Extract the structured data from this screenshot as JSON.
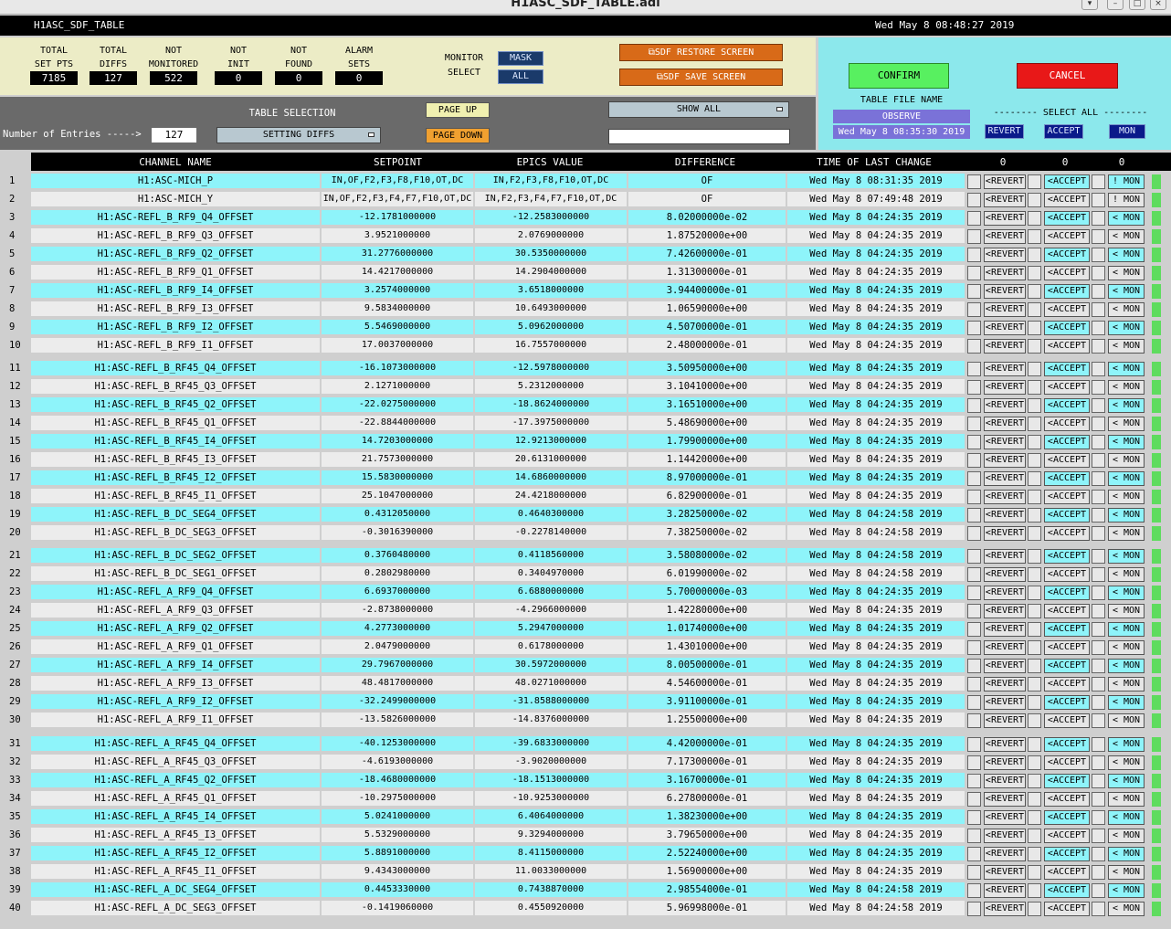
{
  "window": {
    "title": "H1ASC_SDF_TABLE.adl",
    "header_left": "H1ASC_SDF_TABLE",
    "header_right": "Wed May  8 08:48:27 2019"
  },
  "stats": [
    {
      "label1": "TOTAL",
      "label2": "SET PTS",
      "value": "7185"
    },
    {
      "label1": "TOTAL",
      "label2": "DIFFS",
      "value": "127"
    },
    {
      "label1": "NOT",
      "label2": "MONITORED",
      "value": "522"
    },
    {
      "label1": "NOT",
      "label2": "INIT",
      "value": "0"
    },
    {
      "label1": "NOT",
      "label2": "FOUND",
      "value": "0"
    },
    {
      "label1": "ALARM",
      "label2": "SETS",
      "value": "0"
    }
  ],
  "monitor": {
    "label1": "MONITOR",
    "label2": "SELECT",
    "mask": "MASK",
    "all": "ALL"
  },
  "restore_label": "SDF RESTORE SCREEN",
  "save_label": "SDF SAVE SCREEN",
  "confirm": "CONFIRM",
  "cancel": "CANCEL",
  "table_file": {
    "label": "TABLE FILE NAME",
    "name": "OBSERVE",
    "time": "Wed May  8 08:35:30 2019"
  },
  "select_all": {
    "label": "-------- SELECT ALL --------",
    "revert": "REVERT",
    "accept": "ACCEPT",
    "mon": "MON"
  },
  "table_selection": {
    "label": "TABLE SELECTION",
    "value": "SETTING DIFFS",
    "entries_label": "Number of Entries ----->",
    "entries": "127",
    "page_up": "PAGE UP",
    "page_down": "PAGE DOWN",
    "show": "SHOW ALL",
    "filter": ""
  },
  "columns": {
    "channel": "CHANNEL NAME",
    "setpoint": "SETPOINT",
    "epics": "EPICS VALUE",
    "diff": "DIFFERENCE",
    "time": "TIME OF LAST CHANGE",
    "count1": "0",
    "count2": "0",
    "count3": "0"
  },
  "rows": [
    [
      "1",
      "H1:ASC-MICH_P",
      "IN,OF,F2,F3,F8,F10,OT,DC",
      "IN,F2,F3,F8,F10,OT,DC",
      "OF",
      "Wed May  8 08:31:35 2019",
      "!",
      "y"
    ],
    [
      "2",
      "H1:ASC-MICH_Y",
      "IN,OF,F2,F3,F4,F7,F10,OT,DC",
      "IN,F2,F3,F4,F7,F10,OT,DC",
      "OF",
      "Wed May  8 07:49:48 2019",
      "!",
      "n"
    ],
    [
      "3",
      "H1:ASC-REFL_B_RF9_Q4_OFFSET",
      "-12.1781000000",
      "-12.2583000000",
      "8.02000000e-02",
      "Wed May  8 04:24:35 2019",
      "<",
      "y"
    ],
    [
      "4",
      "H1:ASC-REFL_B_RF9_Q3_OFFSET",
      "3.9521000000",
      "2.0769000000",
      "1.87520000e+00",
      "Wed May  8 04:24:35 2019",
      "<",
      "n"
    ],
    [
      "5",
      "H1:ASC-REFL_B_RF9_Q2_OFFSET",
      "31.2776000000",
      "30.5350000000",
      "7.42600000e-01",
      "Wed May  8 04:24:35 2019",
      "<",
      "y"
    ],
    [
      "6",
      "H1:ASC-REFL_B_RF9_Q1_OFFSET",
      "14.4217000000",
      "14.2904000000",
      "1.31300000e-01",
      "Wed May  8 04:24:35 2019",
      "<",
      "n"
    ],
    [
      "7",
      "H1:ASC-REFL_B_RF9_I4_OFFSET",
      "3.2574000000",
      "3.6518000000",
      "3.94400000e-01",
      "Wed May  8 04:24:35 2019",
      "<",
      "y"
    ],
    [
      "8",
      "H1:ASC-REFL_B_RF9_I3_OFFSET",
      "9.5834000000",
      "10.6493000000",
      "1.06590000e+00",
      "Wed May  8 04:24:35 2019",
      "<",
      "n"
    ],
    [
      "9",
      "H1:ASC-REFL_B_RF9_I2_OFFSET",
      "5.5469000000",
      "5.0962000000",
      "4.50700000e-01",
      "Wed May  8 04:24:35 2019",
      "<",
      "y"
    ],
    [
      "10",
      "H1:ASC-REFL_B_RF9_I1_OFFSET",
      "17.0037000000",
      "16.7557000000",
      "2.48000000e-01",
      "Wed May  8 04:24:35 2019",
      "<",
      "n"
    ],
    [
      "11",
      "H1:ASC-REFL_B_RF45_Q4_OFFSET",
      "-16.1073000000",
      "-12.5978000000",
      "3.50950000e+00",
      "Wed May  8 04:24:35 2019",
      "<",
      "y"
    ],
    [
      "12",
      "H1:ASC-REFL_B_RF45_Q3_OFFSET",
      "2.1271000000",
      "5.2312000000",
      "3.10410000e+00",
      "Wed May  8 04:24:35 2019",
      "<",
      "n"
    ],
    [
      "13",
      "H1:ASC-REFL_B_RF45_Q2_OFFSET",
      "-22.0275000000",
      "-18.8624000000",
      "3.16510000e+00",
      "Wed May  8 04:24:35 2019",
      "<",
      "y"
    ],
    [
      "14",
      "H1:ASC-REFL_B_RF45_Q1_OFFSET",
      "-22.8844000000",
      "-17.3975000000",
      "5.48690000e+00",
      "Wed May  8 04:24:35 2019",
      "<",
      "n"
    ],
    [
      "15",
      "H1:ASC-REFL_B_RF45_I4_OFFSET",
      "14.7203000000",
      "12.9213000000",
      "1.79900000e+00",
      "Wed May  8 04:24:35 2019",
      "<",
      "y"
    ],
    [
      "16",
      "H1:ASC-REFL_B_RF45_I3_OFFSET",
      "21.7573000000",
      "20.6131000000",
      "1.14420000e+00",
      "Wed May  8 04:24:35 2019",
      "<",
      "n"
    ],
    [
      "17",
      "H1:ASC-REFL_B_RF45_I2_OFFSET",
      "15.5830000000",
      "14.6860000000",
      "8.97000000e-01",
      "Wed May  8 04:24:35 2019",
      "<",
      "y"
    ],
    [
      "18",
      "H1:ASC-REFL_B_RF45_I1_OFFSET",
      "25.1047000000",
      "24.4218000000",
      "6.82900000e-01",
      "Wed May  8 04:24:35 2019",
      "<",
      "n"
    ],
    [
      "19",
      "H1:ASC-REFL_B_DC_SEG4_OFFSET",
      "0.4312050000",
      "0.4640300000",
      "3.28250000e-02",
      "Wed May  8 04:24:58 2019",
      "<",
      "y"
    ],
    [
      "20",
      "H1:ASC-REFL_B_DC_SEG3_OFFSET",
      "-0.3016390000",
      "-0.2278140000",
      "7.38250000e-02",
      "Wed May  8 04:24:58 2019",
      "<",
      "n"
    ],
    [
      "21",
      "H1:ASC-REFL_B_DC_SEG2_OFFSET",
      "0.3760480000",
      "0.4118560000",
      "3.58080000e-02",
      "Wed May  8 04:24:58 2019",
      "<",
      "y"
    ],
    [
      "22",
      "H1:ASC-REFL_B_DC_SEG1_OFFSET",
      "0.2802980000",
      "0.3404970000",
      "6.01990000e-02",
      "Wed May  8 04:24:58 2019",
      "<",
      "n"
    ],
    [
      "23",
      "H1:ASC-REFL_A_RF9_Q4_OFFSET",
      "6.6937000000",
      "6.6880000000",
      "5.70000000e-03",
      "Wed May  8 04:24:35 2019",
      "<",
      "y"
    ],
    [
      "24",
      "H1:ASC-REFL_A_RF9_Q3_OFFSET",
      "-2.8738000000",
      "-4.2966000000",
      "1.42280000e+00",
      "Wed May  8 04:24:35 2019",
      "<",
      "n"
    ],
    [
      "25",
      "H1:ASC-REFL_A_RF9_Q2_OFFSET",
      "4.2773000000",
      "5.2947000000",
      "1.01740000e+00",
      "Wed May  8 04:24:35 2019",
      "<",
      "y"
    ],
    [
      "26",
      "H1:ASC-REFL_A_RF9_Q1_OFFSET",
      "2.0479000000",
      "0.6178000000",
      "1.43010000e+00",
      "Wed May  8 04:24:35 2019",
      "<",
      "n"
    ],
    [
      "27",
      "H1:ASC-REFL_A_RF9_I4_OFFSET",
      "29.7967000000",
      "30.5972000000",
      "8.00500000e-01",
      "Wed May  8 04:24:35 2019",
      "<",
      "y"
    ],
    [
      "28",
      "H1:ASC-REFL_A_RF9_I3_OFFSET",
      "48.4817000000",
      "48.0271000000",
      "4.54600000e-01",
      "Wed May  8 04:24:35 2019",
      "<",
      "n"
    ],
    [
      "29",
      "H1:ASC-REFL_A_RF9_I2_OFFSET",
      "-32.2499000000",
      "-31.8588000000",
      "3.91100000e-01",
      "Wed May  8 04:24:35 2019",
      "<",
      "y"
    ],
    [
      "30",
      "H1:ASC-REFL_A_RF9_I1_OFFSET",
      "-13.5826000000",
      "-14.8376000000",
      "1.25500000e+00",
      "Wed May  8 04:24:35 2019",
      "<",
      "n"
    ],
    [
      "31",
      "H1:ASC-REFL_A_RF45_Q4_OFFSET",
      "-40.1253000000",
      "-39.6833000000",
      "4.42000000e-01",
      "Wed May  8 04:24:35 2019",
      "<",
      "y"
    ],
    [
      "32",
      "H1:ASC-REFL_A_RF45_Q3_OFFSET",
      "-4.6193000000",
      "-3.9020000000",
      "7.17300000e-01",
      "Wed May  8 04:24:35 2019",
      "<",
      "n"
    ],
    [
      "33",
      "H1:ASC-REFL_A_RF45_Q2_OFFSET",
      "-18.4680000000",
      "-18.1513000000",
      "3.16700000e-01",
      "Wed May  8 04:24:35 2019",
      "<",
      "y"
    ],
    [
      "34",
      "H1:ASC-REFL_A_RF45_Q1_OFFSET",
      "-10.2975000000",
      "-10.9253000000",
      "6.27800000e-01",
      "Wed May  8 04:24:35 2019",
      "<",
      "n"
    ],
    [
      "35",
      "H1:ASC-REFL_A_RF45_I4_OFFSET",
      "5.0241000000",
      "6.4064000000",
      "1.38230000e+00",
      "Wed May  8 04:24:35 2019",
      "<",
      "y"
    ],
    [
      "36",
      "H1:ASC-REFL_A_RF45_I3_OFFSET",
      "5.5329000000",
      "9.3294000000",
      "3.79650000e+00",
      "Wed May  8 04:24:35 2019",
      "<",
      "n"
    ],
    [
      "37",
      "H1:ASC-REFL_A_RF45_I2_OFFSET",
      "5.8891000000",
      "8.4115000000",
      "2.52240000e+00",
      "Wed May  8 04:24:35 2019",
      "<",
      "y"
    ],
    [
      "38",
      "H1:ASC-REFL_A_RF45_I1_OFFSET",
      "9.4343000000",
      "11.0033000000",
      "1.56900000e+00",
      "Wed May  8 04:24:35 2019",
      "<",
      "n"
    ],
    [
      "39",
      "H1:ASC-REFL_A_DC_SEG4_OFFSET",
      "0.4453330000",
      "0.7438870000",
      "2.98554000e-01",
      "Wed May  8 04:24:58 2019",
      "<",
      "y"
    ],
    [
      "40",
      "H1:ASC-REFL_A_DC_SEG3_OFFSET",
      "-0.1419060000",
      "0.4550920000",
      "5.96998000e-01",
      "Wed May  8 04:24:58 2019",
      "<",
      "n"
    ]
  ],
  "row_buttons": {
    "revert": "<REVERT",
    "accept": "<ACCEPT",
    "mon": "MON"
  },
  "colors": {
    "cyan": "#8ef4fa",
    "grey_row": "#ececec",
    "confirm": "#58f060",
    "cancel": "#e81818",
    "accent_orange": "#d86a18"
  }
}
